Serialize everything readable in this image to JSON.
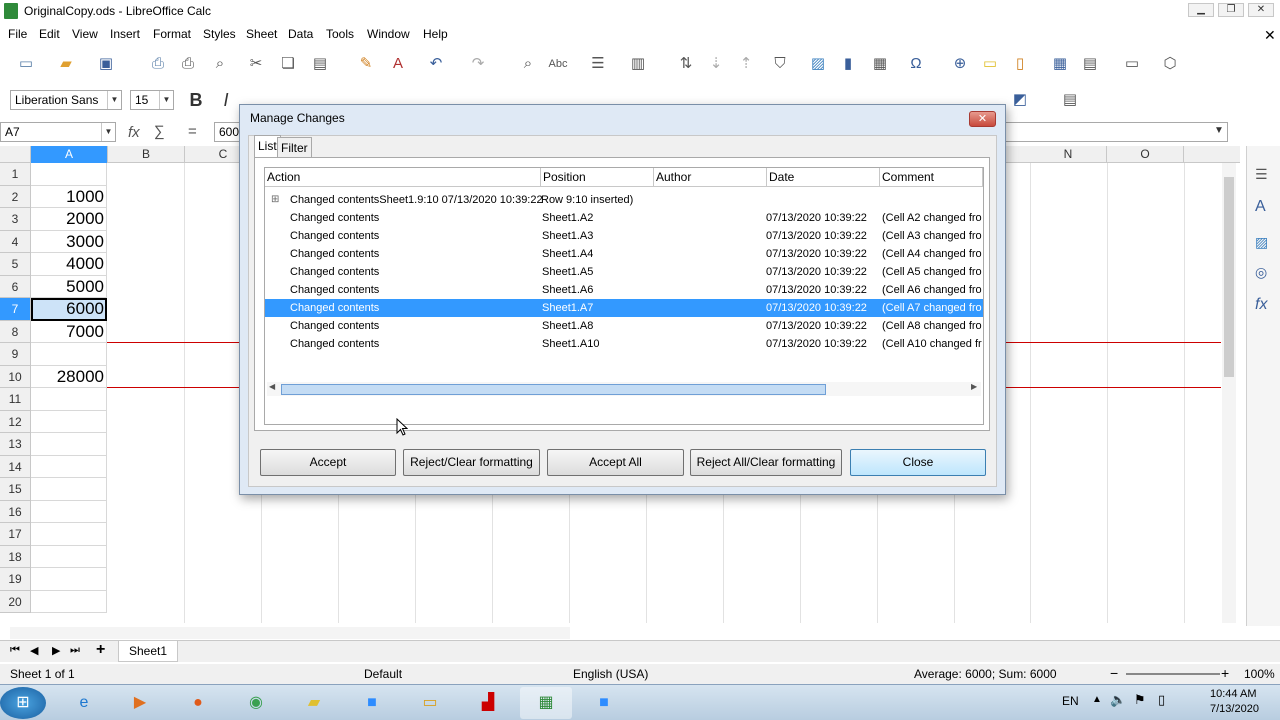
{
  "window": {
    "title": "OriginalCopy.ods - LibreOffice Calc"
  },
  "menu": [
    "File",
    "Edit",
    "View",
    "Insert",
    "Format",
    "Styles",
    "Sheet",
    "Data",
    "Tools",
    "Window",
    "Help"
  ],
  "font": {
    "name": "Liberation Sans",
    "size": "15"
  },
  "formula": {
    "cell_ref": "A7",
    "value": "6000"
  },
  "columns": [
    "A",
    "B",
    "C",
    "N",
    "O"
  ],
  "rows": [
    {
      "num": "1",
      "a": ""
    },
    {
      "num": "2",
      "a": "1000"
    },
    {
      "num": "3",
      "a": "2000"
    },
    {
      "num": "4",
      "a": "3000"
    },
    {
      "num": "5",
      "a": "4000"
    },
    {
      "num": "6",
      "a": "5000"
    },
    {
      "num": "7",
      "a": "6000"
    },
    {
      "num": "8",
      "a": "7000"
    },
    {
      "num": "9",
      "a": ""
    },
    {
      "num": "10",
      "a": "28000"
    },
    {
      "num": "11",
      "a": ""
    },
    {
      "num": "12",
      "a": ""
    },
    {
      "num": "13",
      "a": ""
    },
    {
      "num": "14",
      "a": ""
    },
    {
      "num": "15",
      "a": ""
    },
    {
      "num": "16",
      "a": ""
    },
    {
      "num": "17",
      "a": ""
    },
    {
      "num": "18",
      "a": ""
    },
    {
      "num": "19",
      "a": ""
    },
    {
      "num": "20",
      "a": ""
    }
  ],
  "dialog": {
    "title": "Manage Changes",
    "tabs": [
      "List",
      "Filter"
    ],
    "headers": [
      "Action",
      "Position",
      "Author",
      "Date",
      "Comment"
    ],
    "expand_symbol": "⊞",
    "rows": [
      {
        "action": "Changed contentsSheet1.9:10 07/13/2020 10:39:22",
        "position": "Row 9:10 inserted)",
        "author": "",
        "date": "",
        "comment": ""
      },
      {
        "action": "Changed contents",
        "position": "Sheet1.A2",
        "author": "",
        "date": "07/13/2020 10:39:22",
        "comment": "(Cell A2 changed fro"
      },
      {
        "action": "Changed contents",
        "position": "Sheet1.A3",
        "author": "",
        "date": "07/13/2020 10:39:22",
        "comment": "(Cell A3 changed fro"
      },
      {
        "action": "Changed contents",
        "position": "Sheet1.A4",
        "author": "",
        "date": "07/13/2020 10:39:22",
        "comment": "(Cell A4 changed fro"
      },
      {
        "action": "Changed contents",
        "position": "Sheet1.A5",
        "author": "",
        "date": "07/13/2020 10:39:22",
        "comment": "(Cell A5 changed fro"
      },
      {
        "action": "Changed contents",
        "position": "Sheet1.A6",
        "author": "",
        "date": "07/13/2020 10:39:22",
        "comment": "(Cell A6 changed fro"
      },
      {
        "action": "Changed contents",
        "position": "Sheet1.A7",
        "author": "",
        "date": "07/13/2020 10:39:22",
        "comment": "(Cell A7 changed fro"
      },
      {
        "action": "Changed contents",
        "position": "Sheet1.A8",
        "author": "",
        "date": "07/13/2020 10:39:22",
        "comment": "(Cell A8 changed fro"
      },
      {
        "action": "Changed contents",
        "position": "Sheet1.A10",
        "author": "",
        "date": "07/13/2020 10:39:22",
        "comment": "(Cell A10 changed fr"
      }
    ],
    "buttons": {
      "accept": "Accept",
      "reject": "Reject/Clear formatting",
      "accept_all": "Accept All",
      "reject_all": "Reject All/Clear formatting",
      "close": "Close"
    }
  },
  "sheet_tab": "Sheet1",
  "status": {
    "sheet": "Sheet 1 of 1",
    "style": "Default",
    "language": "English (USA)",
    "summary": "Average: 6000; Sum: 6000",
    "zoom": "100%"
  },
  "taskbar": {
    "lang": "EN",
    "time": "10:44 AM",
    "date": "7/13/2020"
  },
  "colors": {
    "selection": "#3399ff",
    "accent": "#3c7fb1",
    "change_marker": "#cc0000"
  }
}
